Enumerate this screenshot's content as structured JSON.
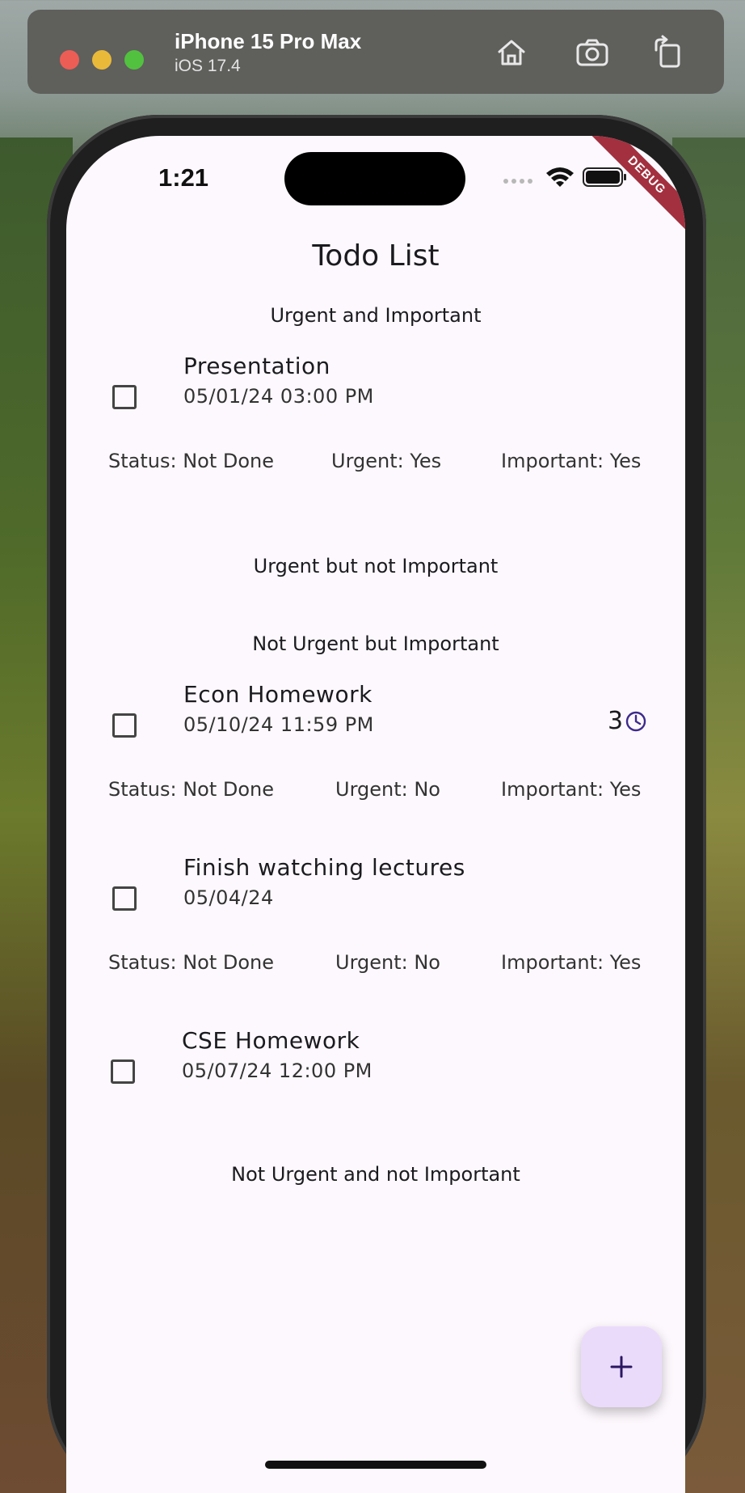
{
  "simulator": {
    "device_name": "iPhone 15 Pro Max",
    "os_version": "iOS 17.4",
    "toolbar_icons": [
      "home-icon",
      "screenshot-icon",
      "rotate-icon"
    ]
  },
  "status_bar": {
    "time": "1:21",
    "debug_banner": "DEBUG"
  },
  "app": {
    "title": "Todo List",
    "fab_icon": "plus-icon"
  },
  "sections": [
    {
      "header": "Urgent and Important",
      "tasks": [
        {
          "name": "Presentation",
          "date": "05/01/24 03:00 PM",
          "status": "Status: Not Done",
          "urgent": "Urgent: Yes",
          "important": "Important: Yes"
        }
      ]
    },
    {
      "header": "Urgent but not Important",
      "tasks": []
    },
    {
      "header": "Not Urgent but Important",
      "tasks": [
        {
          "name": "Econ Homework",
          "date": "05/10/24 11:59 PM",
          "reminder_count": "3",
          "reminder_icon": "clock-icon",
          "status": "Status: Not Done",
          "urgent": "Urgent: No",
          "important": "Important: Yes"
        },
        {
          "name": "Finish watching lectures",
          "date": "05/04/24",
          "status": "Status: Not Done",
          "urgent": "Urgent: No",
          "important": "Important: Yes"
        },
        {
          "name": "CSE Homework",
          "date": "05/07/24 12:00 PM"
        }
      ]
    },
    {
      "header": "Not Urgent and not Important",
      "tasks": []
    }
  ],
  "colors": {
    "screen_bg": "#fdf8fd",
    "fab_bg": "#eadbfb",
    "accent": "#3d2a8c",
    "debug_ribbon": "#a3303f"
  }
}
